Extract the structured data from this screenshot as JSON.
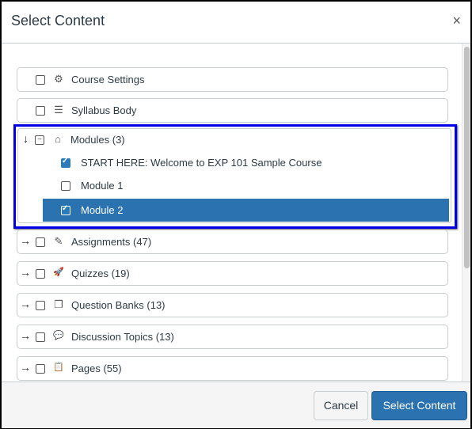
{
  "dialog": {
    "title": "Select Content",
    "close_icon": "×"
  },
  "items": [
    {
      "label": "Course Settings",
      "icon": "gear-icon",
      "glyph": "⚙",
      "checked": false,
      "expander": ""
    },
    {
      "label": "Syllabus Body",
      "icon": "syllabus-icon",
      "glyph": "☰",
      "checked": false,
      "expander": ""
    },
    {
      "label": "Modules (3)",
      "icon": "modules-icon",
      "glyph": "⌂",
      "checked": "partial",
      "expander": "↓"
    },
    {
      "label": "Assignments (47)",
      "icon": "assignment-icon",
      "glyph": "✎",
      "checked": false,
      "expander": "→"
    },
    {
      "label": "Quizzes (19)",
      "icon": "quiz-icon",
      "glyph": "🚀",
      "checked": false,
      "expander": "→"
    },
    {
      "label": "Question Banks (13)",
      "icon": "question-bank-icon",
      "glyph": "❐",
      "checked": false,
      "expander": "→"
    },
    {
      "label": "Discussion Topics (13)",
      "icon": "discussion-icon",
      "glyph": "💬",
      "checked": false,
      "expander": "→"
    },
    {
      "label": "Pages (55)",
      "icon": "pages-icon",
      "glyph": "📋",
      "checked": false,
      "expander": "→"
    }
  ],
  "modules": [
    {
      "label": "START HERE: Welcome to EXP 101 Sample Course",
      "checked": true,
      "selected": false
    },
    {
      "label": "Module 1",
      "checked": false,
      "selected": false
    },
    {
      "label": "Module 2",
      "checked": true,
      "selected": true
    }
  ],
  "partial_glyph": "−",
  "footer": {
    "cancel_label": "Cancel",
    "select_label": "Select Content"
  },
  "colors": {
    "accent": "#2b72b0",
    "highlight_border": "#0000e6"
  }
}
